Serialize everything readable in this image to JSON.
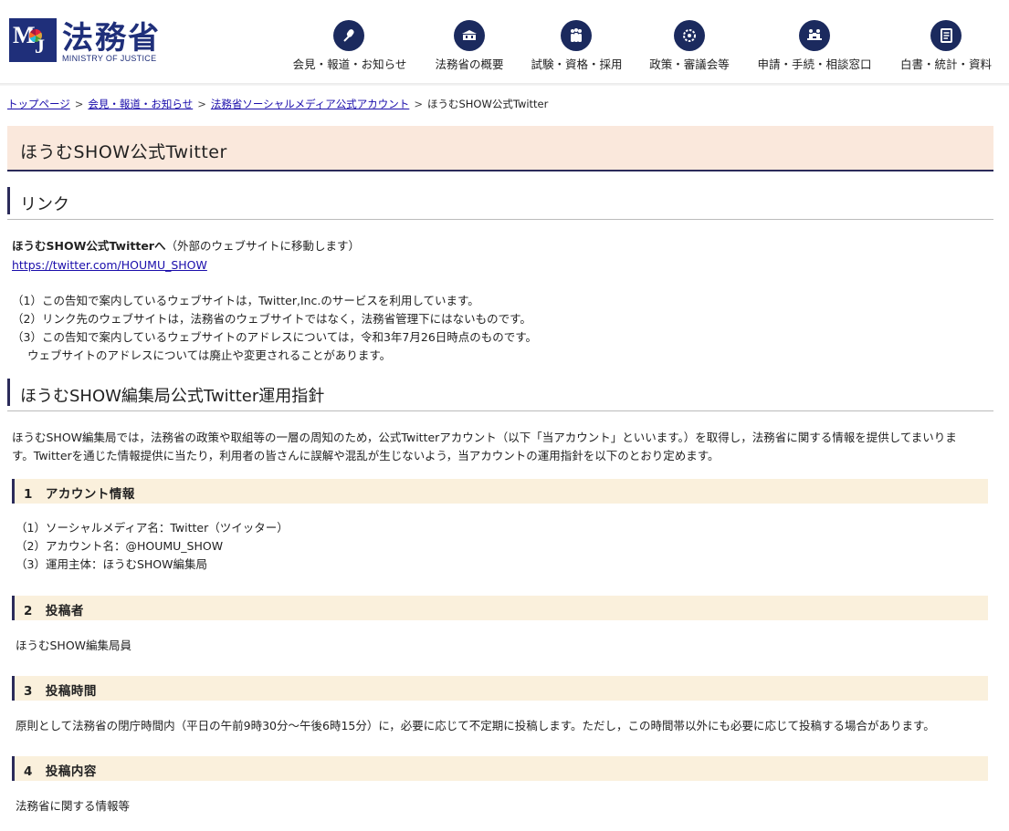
{
  "header": {
    "logo_kanji": "法務省",
    "logo_en": "MINISTRY OF JUSTICE",
    "nav": [
      {
        "label": "会見・報道・お知らせ",
        "icon": "microphone-icon"
      },
      {
        "label": "法務省の概要",
        "icon": "building-icon"
      },
      {
        "label": "試験・資格・採用",
        "icon": "people-icon"
      },
      {
        "label": "政策・審議会等",
        "icon": "circle-network-icon"
      },
      {
        "label": "申請・手続・相談窓口",
        "icon": "counter-desk-icon"
      },
      {
        "label": "白書・統計・資料",
        "icon": "document-icon"
      }
    ]
  },
  "breadcrumb": {
    "items": [
      "トップページ",
      "会見・報道・お知らせ",
      "法務省ソーシャルメディア公式アカウント"
    ],
    "current": "ほうむSHOW公式Twitter",
    "separator": ">"
  },
  "page_title": "ほうむSHOW公式Twitter",
  "link_section": {
    "heading": "リンク",
    "link_title": "ほうむSHOW公式Twitterへ",
    "link_note": "（外部のウェブサイトに移動します）",
    "url": "https://twitter.com/HOUMU_SHOW",
    "notes": [
      "（1）この告知で案内しているウェブサイトは，Twitter,Inc.のサービスを利用しています。",
      "（2）リンク先のウェブサイトは，法務省のウェブサイトではなく，法務省管理下にはないものです。",
      "（3）この告知で案内しているウェブサイトのアドレスについては，令和3年7月26日時点のものです。",
      "ウェブサイトのアドレスについては廃止や変更されることがあります。"
    ]
  },
  "policy_section": {
    "heading": "ほうむSHOW編集局公式Twitter運用指針",
    "intro_1": "ほうむSHOW編集局では，法務省の政策や取組等の一層の周知のため，公式Twitterアカウント（以下「当アカウント」といいます。）を取得し，法務省に関する情報を提供してまいりま",
    "intro_2": "す。Twitterを通じた情報提供に当たり，利用者の皆さんに誤解や混乱が生じないよう，当アカウントの運用指針を以下のとおり定めます。",
    "sub1_heading": "1　アカウント情報",
    "sub1_items": [
      "（1）ソーシャルメディア名：Twitter（ツイッター）",
      "（2）アカウント名：@HOUMU_SHOW",
      "（3）運用主体：ほうむSHOW編集局"
    ],
    "sub2_heading": "2　投稿者",
    "sub2_text": "ほうむSHOW編集局員",
    "sub3_heading": "3　投稿時間",
    "sub3_text": "原則として法務省の閉庁時間内（平日の午前9時30分～午後6時15分）に，必要に応じて不定期に投稿します。ただし，この時間帯以外にも必要に応じて投稿する場合があります。",
    "sub4_heading": "4　投稿内容",
    "sub4_text": "法務省に関する情報等"
  },
  "colors": {
    "brand_navy": "#1f2f7a",
    "nav_icon_bg": "#1b2a5e",
    "title_bg": "#fae8dc",
    "subhead_bg": "#faf0dc",
    "link": "#1a0dab"
  }
}
